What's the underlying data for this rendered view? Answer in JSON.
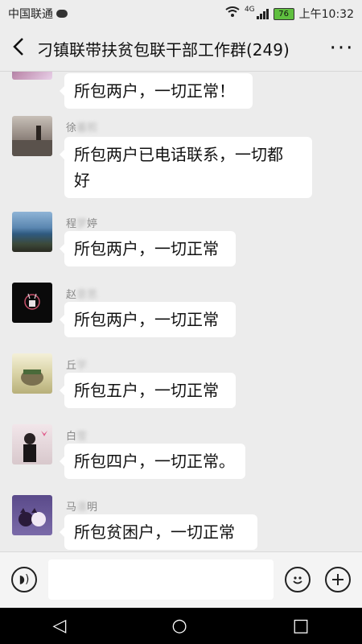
{
  "status": {
    "carrier": "中国联通",
    "network": "4G",
    "battery": "76",
    "time": "上午10:32"
  },
  "header": {
    "back_icon": "chevron-left-icon",
    "title": "刁镇联带扶贫包联干部工作群(249)",
    "more_icon": "more-dots-icon"
  },
  "messages": [
    {
      "name": "",
      "text": "所包两户，一切正常！"
    },
    {
      "name_visible": "徐",
      "name_blur": "蕃熙",
      "text_line1": "所包两户已电话联系，一切都",
      "text_line2": "好"
    },
    {
      "name_visible": "程",
      "name_blur": "梦",
      "name_tail": "婷",
      "text": "所包两户，一切正常"
    },
    {
      "name_visible": "赵",
      "name_blur": "意思",
      "text": "所包两户，一切正常"
    },
    {
      "name_visible": "丘",
      "name_blur": "学",
      "text": "所包五户，一切正常"
    },
    {
      "name_visible": "白",
      "name_blur": "雪",
      "text": "所包四户，一切正常。"
    },
    {
      "name_visible": "马",
      "name_blur": "凛",
      "name_tail": "明",
      "text": "所包贫困户，一切正常"
    }
  ],
  "inputbar": {
    "voice_icon": "voice-icon",
    "emoji_icon": "emoji-icon",
    "plus_icon": "plus-icon"
  },
  "navbar": {
    "back": "◁",
    "home": "○",
    "recent": "□"
  }
}
